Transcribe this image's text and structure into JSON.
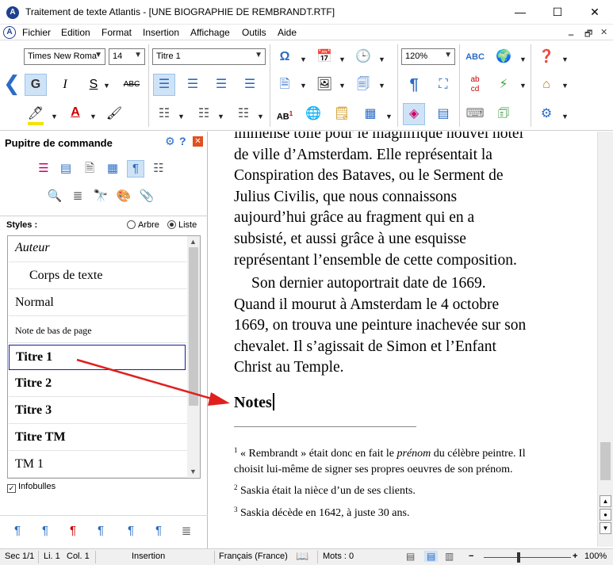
{
  "window": {
    "title": "Traitement de texte Atlantis - [UNE BIOGRAPHIE DE REMBRANDT.RTF]",
    "app_icon": "A",
    "controls": {
      "minimize": "—",
      "maximize": "☐",
      "close": "✕"
    }
  },
  "menu": {
    "items": [
      "Fichier",
      "Edition",
      "Format",
      "Insertion",
      "Affichage",
      "Outils",
      "Aide"
    ],
    "mdi": {
      "minimize": "‗",
      "restore": "🗗",
      "close": "✕"
    }
  },
  "ribbon": {
    "font_name": "Times New Roma",
    "font_size": "14",
    "style": "Titre 1",
    "zoom": "120%",
    "bold_label": "G",
    "italic_label": "I",
    "underline_label": "S",
    "strike_label": "ABC",
    "ab_label": "AB",
    "abcd_label": "ab\ncd",
    "abc_label": "ABC"
  },
  "panel": {
    "title": "Pupitre de commande",
    "styles_label": "Styles :",
    "view_tree": "Arbre",
    "view_list": "Liste",
    "styles": [
      "Auteur",
      "Corps de texte",
      "Normal",
      "Note de bas de page",
      "Titre 1",
      "Titre 2",
      "Titre 3",
      "Titre TM",
      "TM 1"
    ],
    "active_style": "Titre 1",
    "infobulles_label": "Infobulles",
    "infobulles_checked": true
  },
  "document": {
    "para1": [
      "immense toile pour le magnifique nouvel hôtel",
      "de ville d’Amsterdam. Elle représentait la",
      "Conspiration des Bataves, ou le Serment de",
      "Julius Civilis, que nous connaissons",
      "aujourd’hui grâce au fragment qui en a",
      "subsisté, et aussi grâce à une esquisse",
      "représentant l’ensemble de cette composition."
    ],
    "para2": [
      "Son dernier autoportrait date de 1669.",
      "Quand il mourut à Amsterdam le 4 octobre",
      "1669, on trouva une peinture inachevée sur son",
      "chevalet. Il s’agissait de Simon et l’Enfant",
      "Christ au Temple."
    ],
    "notes_heading": "Notes",
    "footnotes": [
      {
        "num": "1",
        "pre": "« Rembrandt » était donc en fait le ",
        "em": "prénom",
        "post": " du célèbre peintre. Il",
        "line2": "choisit lui-même de signer ses propres oeuvres de son prénom."
      },
      {
        "num": "2",
        "text": "Saskia était la nièce d’un de ses clients."
      },
      {
        "num": "3",
        "text": "Saskia décède en 1642, à juste 30 ans."
      }
    ]
  },
  "status": {
    "section": "Sec 1/1",
    "line": "Li. 1",
    "col": "Col. 1",
    "mode": "Insertion",
    "language": "Français (France)",
    "words": "Mots : 0",
    "zoom": "100%"
  },
  "colors": {
    "accent": "#2b6cc4",
    "arrow": "#e0201e",
    "selection": "#cfe3f7"
  }
}
